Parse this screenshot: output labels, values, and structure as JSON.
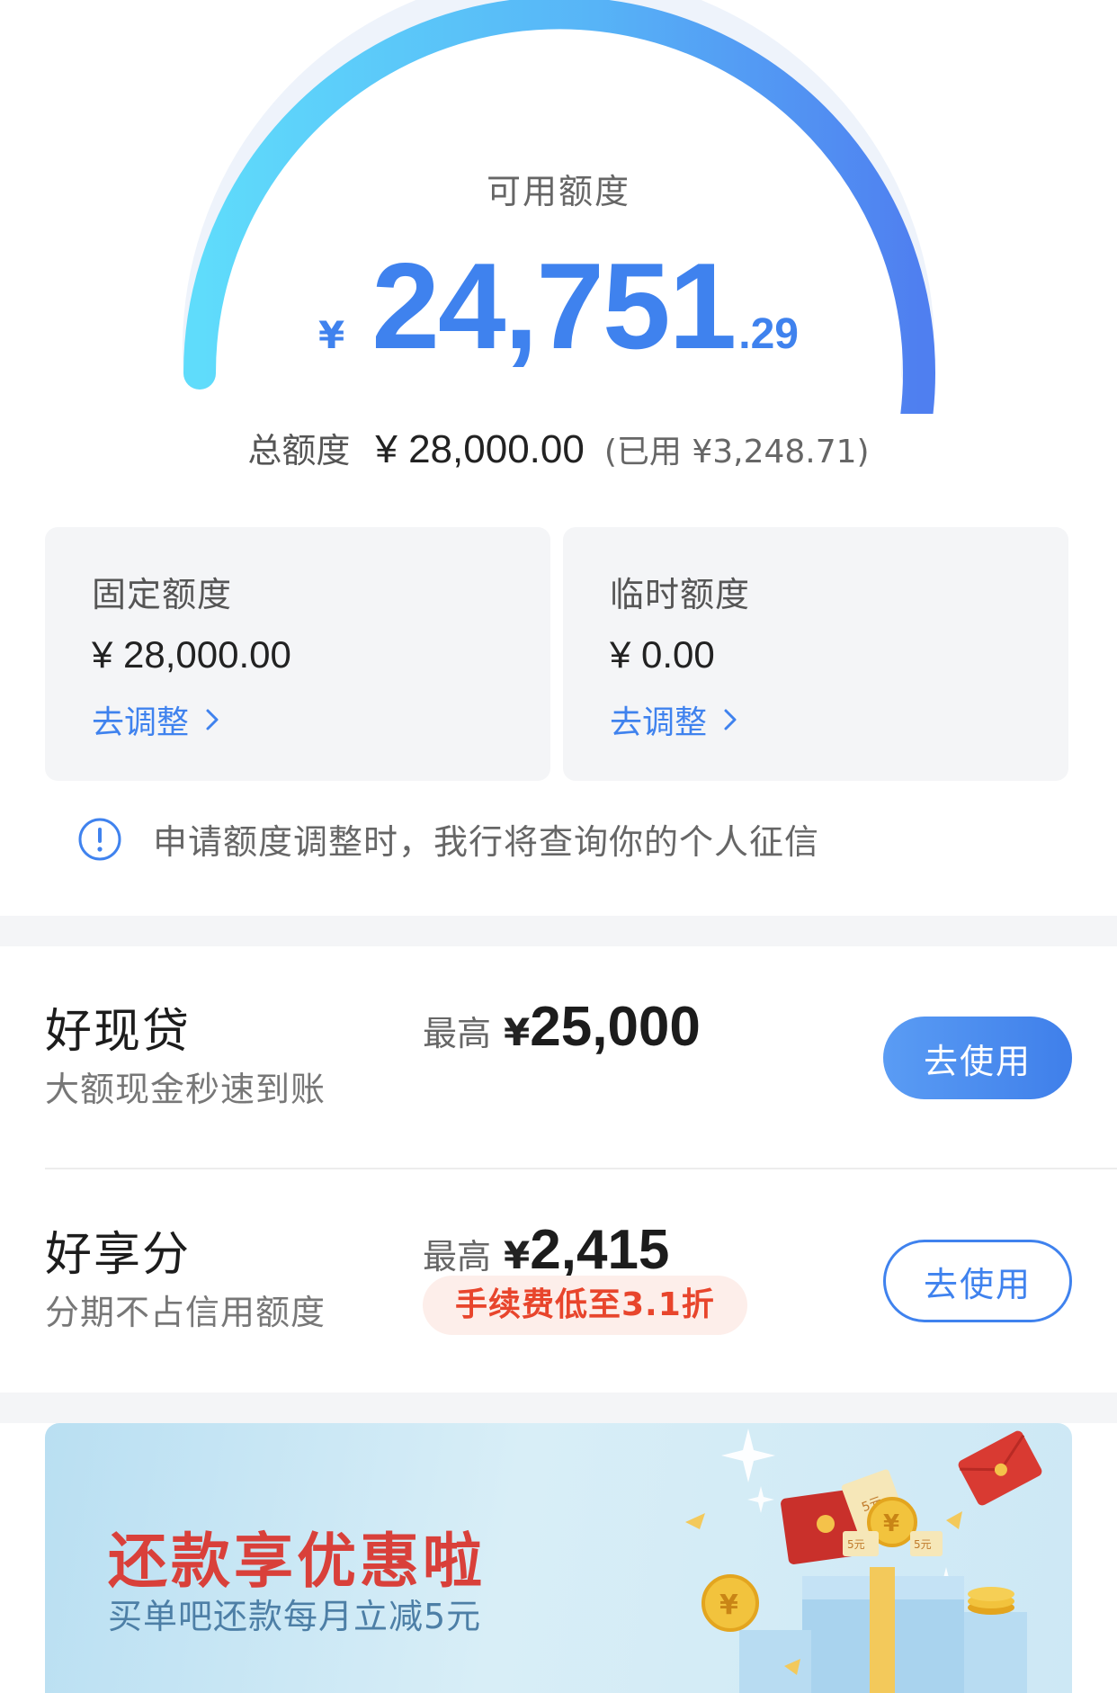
{
  "gauge": {
    "label": "可用额度",
    "currency": "¥",
    "integer": "24,751",
    "decimal": ".29",
    "used_fraction": 0.116
  },
  "total": {
    "label": "总额度",
    "value": "¥ 28,000.00",
    "used": "(已用 ¥3,248.71)"
  },
  "quota_cards": [
    {
      "title": "固定额度",
      "value": "¥ 28,000.00",
      "link": "去调整"
    },
    {
      "title": "临时额度",
      "value": "¥ 0.00",
      "link": "去调整"
    }
  ],
  "notice": {
    "icon": "info-icon",
    "text": "申请额度调整时，我行将查询你的个人征信"
  },
  "products": [
    {
      "name": "好现贷",
      "desc": "大额现金秒速到账",
      "max_label": "最高",
      "max_currency": "¥",
      "max_value": "25,000",
      "button": "去使用"
    },
    {
      "name": "好享分",
      "desc": "分期不占信用额度",
      "max_label": "最高",
      "max_currency": "¥",
      "max_value": "2,415",
      "badge": "手续费低至3.1折",
      "button": "去使用"
    }
  ],
  "banner": {
    "title": "还款享优惠啦",
    "subtitle": "买单吧还款每月立减5元",
    "coin_labels": [
      "5元",
      "5元",
      "5元"
    ]
  },
  "colors": {
    "accent": "#3f82ee",
    "gauge_start": "#5fdcfb",
    "gauge_end": "#4f7ff0",
    "track": "#eef3fb",
    "fee_red": "#e8452c",
    "banner_red": "#d9403a"
  }
}
